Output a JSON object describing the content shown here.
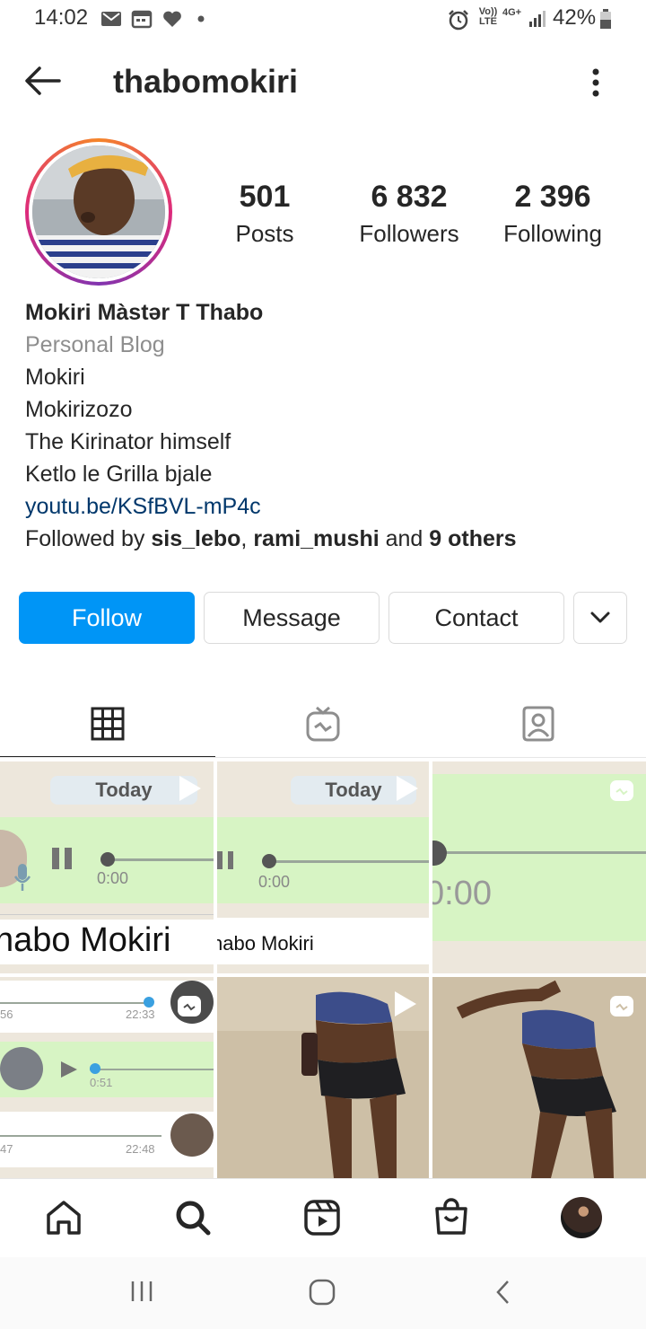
{
  "status_bar": {
    "time": "14:02",
    "battery": "42%",
    "network_label": "4G+",
    "volte_label": "Vo)) LTE"
  },
  "header": {
    "username": "thabomokiri",
    "back_icon": "arrow-left-icon",
    "more_icon": "vertical-ellipsis-icon"
  },
  "profile": {
    "stats": [
      {
        "value": "501",
        "label": "Posts"
      },
      {
        "value": "6 832",
        "label": "Followers"
      },
      {
        "value": "2 396",
        "label": "Following"
      }
    ],
    "full_name": "Mokiri Màstər T Thabo",
    "category": "Personal Blog",
    "bio_lines": [
      "Mokiri",
      "Mokirizozo",
      "The Kirinator himself",
      "Ketlo le Grilla bjale"
    ],
    "link": "youtu.be/KSfBVL-mP4c",
    "followed_by": {
      "prefix": "Followed by ",
      "user1": "sis_lebo",
      "sep": ", ",
      "user2": "rami_mushi",
      "mid": " and ",
      "others": "9 others"
    }
  },
  "actions": {
    "follow": "Follow",
    "message": "Message",
    "contact": "Contact"
  },
  "tabs": [
    {
      "name": "grid",
      "icon": "grid-icon",
      "active": true
    },
    {
      "name": "igtv",
      "icon": "igtv-icon",
      "active": false
    },
    {
      "name": "tagged",
      "icon": "tagged-person-icon",
      "active": false
    }
  ],
  "grid_posts": {
    "p1": {
      "today": "Today",
      "time": "0:00",
      "name": "habo Mokiri"
    },
    "p2": {
      "today": "Today",
      "time": "0:00",
      "name": "habo Mokiri"
    },
    "p3": {
      "time": "0:00"
    },
    "p4": {
      "t1": "56",
      "t2": "22:33",
      "t3": "0:51",
      "t4": "47",
      "t5": "22:48"
    }
  },
  "bottom_nav": [
    "home-icon",
    "search-icon",
    "reels-icon",
    "shop-icon",
    "profile-avatar"
  ],
  "colors": {
    "accent": "#0095f6",
    "link": "#00376b",
    "whatsapp_green": "#dcf8c6"
  }
}
